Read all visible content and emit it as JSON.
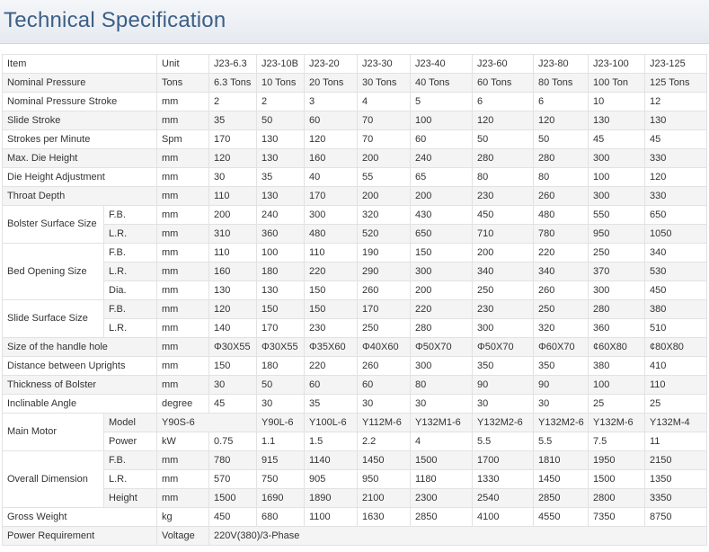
{
  "title": "Technical Specification",
  "header": [
    "Item",
    "Unit",
    "J23-6.3",
    "J23-10B",
    "J23-20",
    "J23-30",
    "J23-40",
    "J23-60",
    "J23-80",
    "J23-100",
    "J23-125"
  ],
  "rows": [
    {
      "item": "Nominal Pressure",
      "unit": "Tons",
      "values": [
        "6.3 Tons",
        "10 Tons",
        "20 Tons",
        "30 Tons",
        "40 Tons",
        "60 Tons",
        "80 Tons",
        "100 Ton",
        "125 Tons"
      ]
    },
    {
      "item": "Nominal Pressure Stroke",
      "unit": "mm",
      "values": [
        "2",
        "2",
        "3",
        "4",
        "5",
        "6",
        "6",
        "10",
        "12"
      ]
    },
    {
      "item": "Slide Stroke",
      "unit": "mm",
      "values": [
        "35",
        "50",
        "60",
        "70",
        "100",
        "120",
        "120",
        "130",
        "130"
      ]
    },
    {
      "item": "Strokes per Minute",
      "unit": "Spm",
      "values": [
        "170",
        "130",
        "120",
        "70",
        "60",
        "50",
        "50",
        "45",
        "45"
      ]
    },
    {
      "item": "Max. Die Height",
      "unit": "mm",
      "values": [
        "120",
        "130",
        "160",
        "200",
        "240",
        "280",
        "280",
        "300",
        "330"
      ]
    },
    {
      "item": "Die Height Adjustment",
      "unit": "mm",
      "values": [
        "30",
        "35",
        "40",
        "55",
        "65",
        "80",
        "80",
        "100",
        "120"
      ]
    },
    {
      "item": "Throat Depth",
      "unit": "mm",
      "values": [
        "110",
        "130",
        "170",
        "200",
        "200",
        "230",
        "260",
        "300",
        "330"
      ]
    }
  ],
  "bolster_surface": {
    "label": "Bolster Surface Size",
    "subs": [
      {
        "sub": "F.B.",
        "unit": "mm",
        "values": [
          "200",
          "240",
          "300",
          "320",
          "430",
          "450",
          "480",
          "550",
          "650"
        ]
      },
      {
        "sub": "L.R.",
        "unit": "mm",
        "values": [
          "310",
          "360",
          "480",
          "520",
          "650",
          "710",
          "780",
          "950",
          "1050"
        ]
      }
    ]
  },
  "bed_opening": {
    "label": "Bed Opening Size",
    "subs": [
      {
        "sub": "F.B.",
        "unit": "mm",
        "values": [
          "110",
          "100",
          "110",
          "190",
          "150",
          "200",
          "220",
          "250",
          "340"
        ]
      },
      {
        "sub": "L.R.",
        "unit": "mm",
        "values": [
          "160",
          "180",
          "220",
          "290",
          "300",
          "340",
          "340",
          "370",
          "530"
        ]
      },
      {
        "sub": "Dia.",
        "unit": "mm",
        "values": [
          "130",
          "130",
          "150",
          "260",
          "200",
          "250",
          "260",
          "300",
          "450"
        ]
      }
    ]
  },
  "slide_surface": {
    "label": "Slide Surface Size",
    "subs": [
      {
        "sub": "F.B.",
        "unit": "mm",
        "values": [
          "120",
          "150",
          "150",
          "170",
          "220",
          "230",
          "250",
          "280",
          "380"
        ]
      },
      {
        "sub": "L.R.",
        "unit": "mm",
        "values": [
          "140",
          "170",
          "230",
          "250",
          "280",
          "300",
          "320",
          "360",
          "510"
        ]
      }
    ]
  },
  "rows2": [
    {
      "item": "Size of the handle hole",
      "unit": "mm",
      "values": [
        "Φ30X55",
        "Φ30X55",
        "Φ35X60",
        "Φ40X60",
        "Φ50X70",
        "Φ50X70",
        "Φ60X70",
        "¢60X80",
        "¢80X80"
      ]
    },
    {
      "item": "Distance between Uprights",
      "unit": "mm",
      "values": [
        "150",
        "180",
        "220",
        "260",
        "300",
        "350",
        "350",
        "380",
        "410"
      ]
    },
    {
      "item": "Thickness of Bolster",
      "unit": "mm",
      "values": [
        "30",
        "50",
        "60",
        "60",
        "80",
        "90",
        "90",
        "100",
        "110"
      ]
    },
    {
      "item": "Inclinable Angle",
      "unit": "degree",
      "values": [
        "45",
        "30",
        "35",
        "30",
        "30",
        "30",
        "30",
        "25",
        "25"
      ]
    }
  ],
  "main_motor": {
    "label": "Main Motor",
    "model": {
      "sub": "Model",
      "unit": "",
      "values": [
        "Y90S-6",
        "Y90L-6",
        "Y100L-6",
        "Y112M-6",
        "Y132M1-6",
        "Y132M2-6",
        "Y132M2-6",
        "Y132M-6",
        "Y132M-4"
      ]
    },
    "power": {
      "sub": "Power",
      "unit": "kW",
      "values": [
        "0.75",
        "1.1",
        "1.5",
        "2.2",
        "4",
        "5.5",
        "5.5",
        "7.5",
        "11"
      ]
    }
  },
  "overall_dimension": {
    "label": "Overall Dimension",
    "subs": [
      {
        "sub": "F.B.",
        "unit": "mm",
        "values": [
          "780",
          "915",
          "1140",
          "1450",
          "1500",
          "1700",
          "1810",
          "1950",
          "2150"
        ]
      },
      {
        "sub": "L.R.",
        "unit": "mm",
        "values": [
          "570",
          "750",
          "905",
          "950",
          "1180",
          "1330",
          "1450",
          "1500",
          "1350"
        ]
      },
      {
        "sub": "Height",
        "unit": "mm",
        "values": [
          "1500",
          "1690",
          "1890",
          "2100",
          "2300",
          "2540",
          "2850",
          "2800",
          "3350"
        ]
      }
    ]
  },
  "gross_weight": {
    "item": "Gross Weight",
    "unit": "kg",
    "values": [
      "450",
      "680",
      "1100",
      "1630",
      "2850",
      "4100",
      "4550",
      "7350",
      "8750"
    ]
  },
  "power_requirement": {
    "item": "Power Requirement",
    "unit": "Voltage",
    "value": "220V(380)/3-Phase"
  }
}
